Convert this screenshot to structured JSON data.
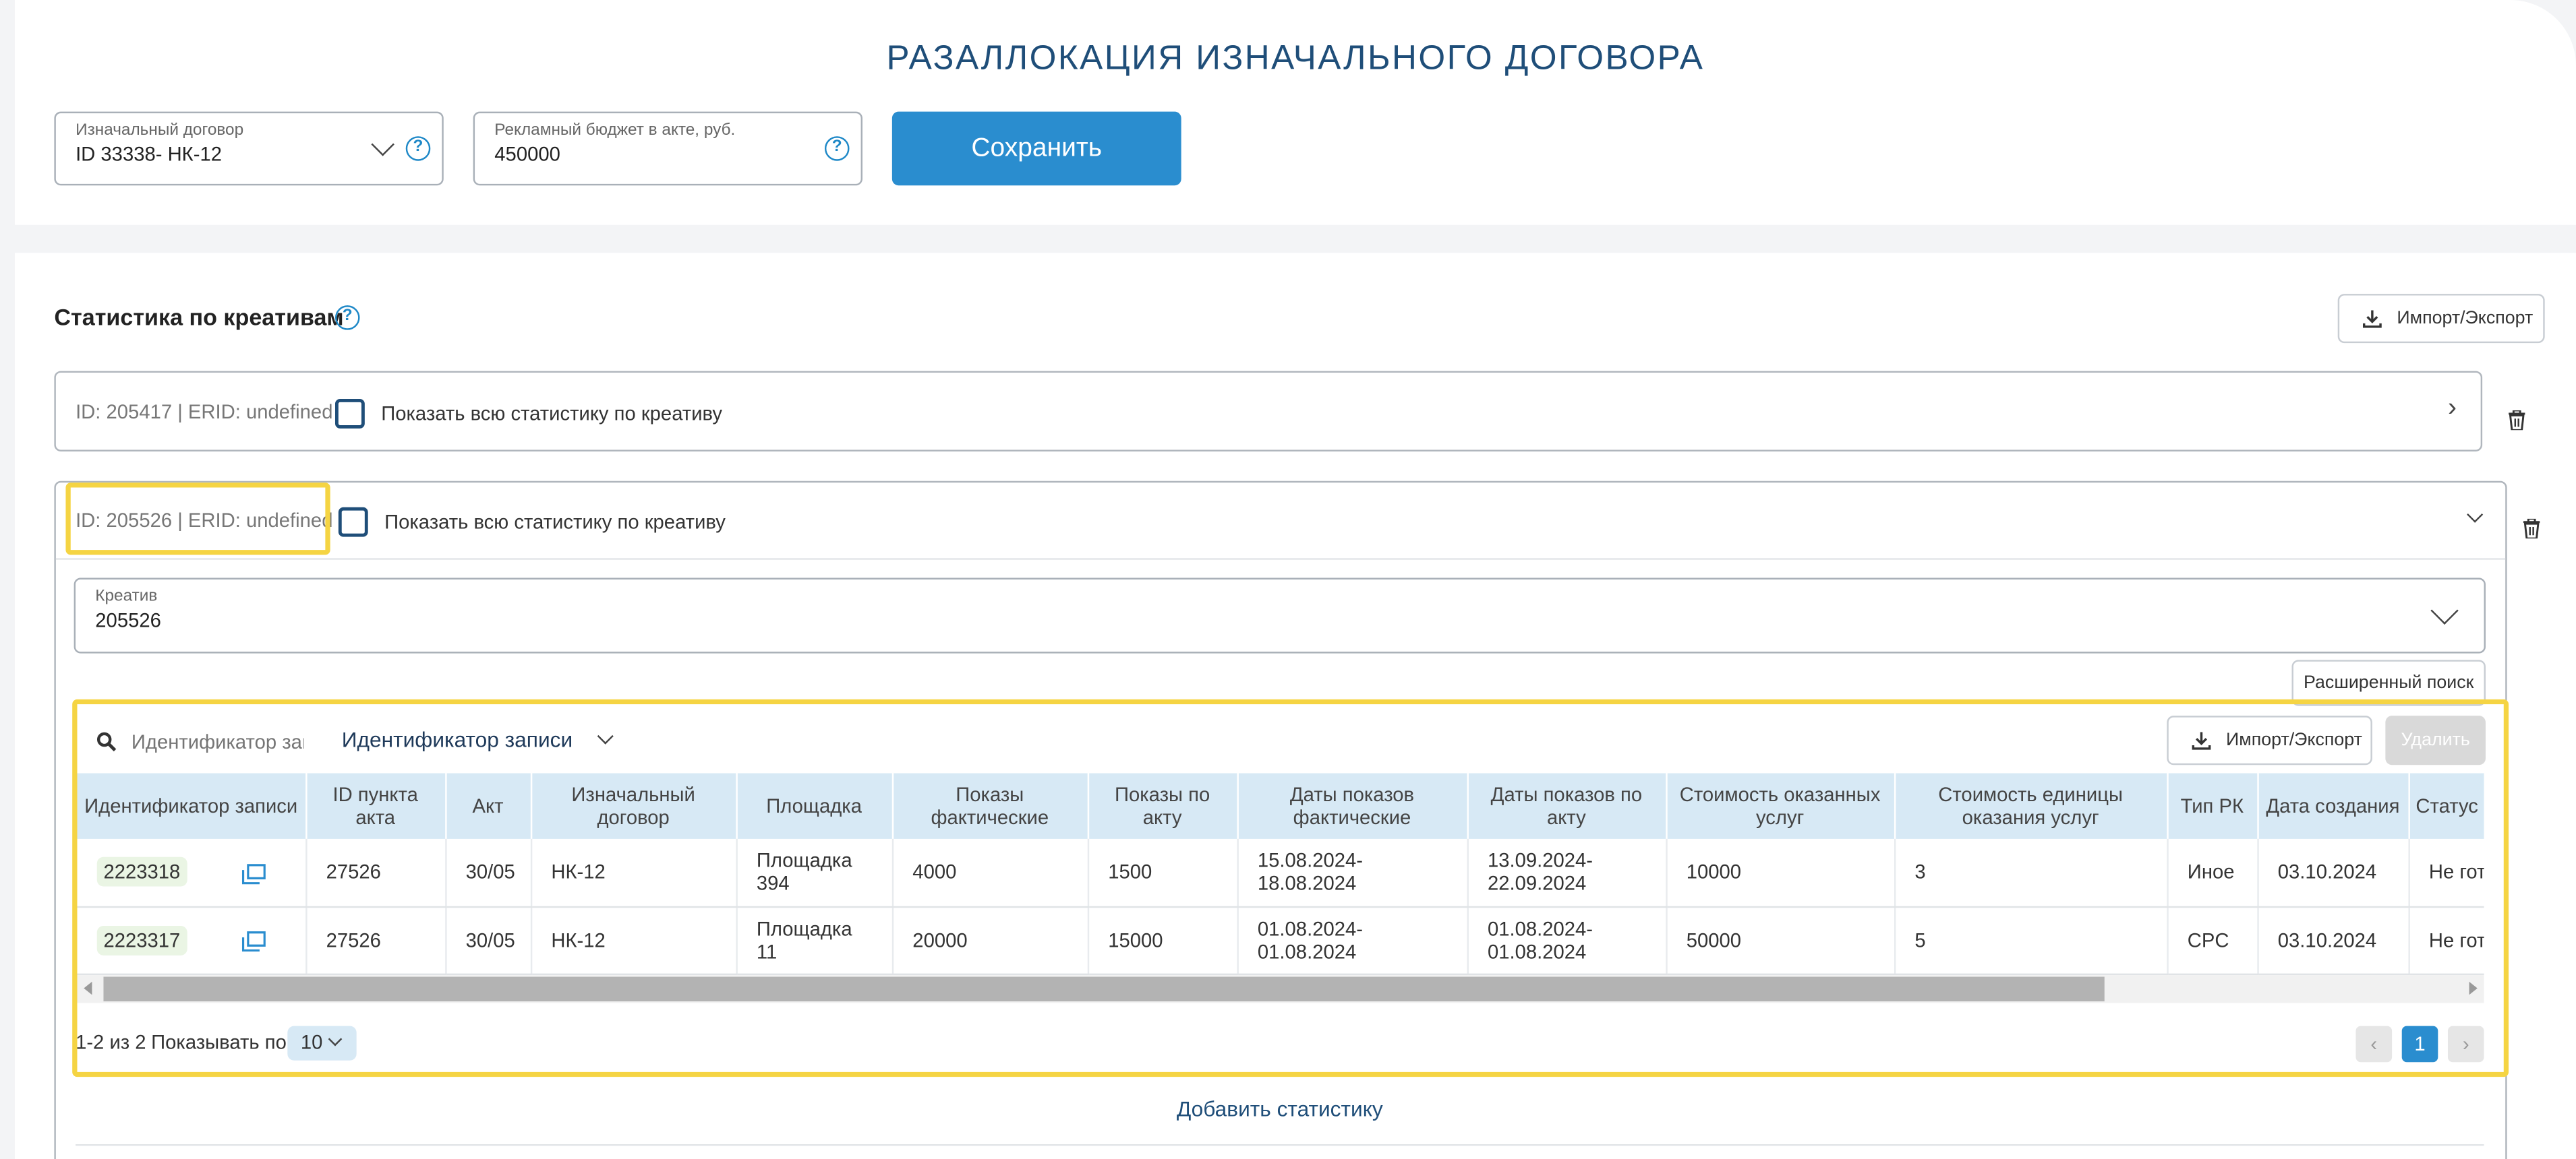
{
  "page_title": "РАЗАЛЛОКАЦИЯ ИЗНАЧАЛЬНОГО ДОГОВОРА",
  "contract_field": {
    "label": "Изначальный договор",
    "value": "ID 33338- НК-12"
  },
  "budget_field": {
    "label": "Рекламный бюджет в акте, руб.",
    "value": "450000"
  },
  "help_glyph": "?",
  "save_label": "Сохранить",
  "section_title": "Статистика по креативам",
  "import_export_label": "Импорт/Экспорт",
  "accordion1": {
    "id_text": "ID: 205417 | ERID: undefined",
    "checkbox_label": "Показать всю статистику по креативу",
    "arrow": "›"
  },
  "accordion2": {
    "id_text": "ID: 205526 | ERID: undefined",
    "checkbox_label": "Показать всю статистику по креативу"
  },
  "creative_field": {
    "label": "Креатив",
    "value": "205526"
  },
  "advanced_search_label": "Расширенный поиск",
  "search": {
    "placeholder": "Идентификатор записи",
    "filter_label": "Идентификатор записи"
  },
  "delete_label": "Удалить",
  "table": {
    "headers": [
      "Идентификатор записи",
      "ID пункта акта",
      "Акт",
      "Изначальный договор",
      "Площадка",
      "Показы фактические",
      "Показы по акту",
      "Даты показов фактические",
      "Даты показов по акту",
      "Стоимость оказанных услуг",
      "Стоимость единицы оказания услуг",
      "Тип РК",
      "Дата создания",
      "Статус"
    ],
    "rows": [
      [
        "2223318",
        "27526",
        "30/05",
        "НК-12",
        "Площадка 394",
        "4000",
        "1500",
        "15.08.2024-18.08.2024",
        "13.09.2024-22.09.2024",
        "10000",
        "3",
        "Иное",
        "03.10.2024",
        "Не готов"
      ],
      [
        "2223317",
        "27526",
        "30/05",
        "НК-12",
        "Площадка 11",
        "20000",
        "15000",
        "01.08.2024-01.08.2024",
        "01.08.2024-01.08.2024",
        "50000",
        "5",
        "CPC",
        "03.10.2024",
        "Не готов"
      ]
    ]
  },
  "pagination": {
    "range_text": "1-2 из 2",
    "per_page_label": "Показывать по",
    "per_page_value": "10",
    "current_page": "1",
    "prev": "‹",
    "next": "›"
  },
  "add_stats_label": "Добавить статистику",
  "colors": {
    "accent": "#2a8dcf",
    "title": "#1f4e79",
    "header_bg": "#d7e9f5",
    "highlight": "#f5d443",
    "badge_bg": "#eaf5e4"
  }
}
